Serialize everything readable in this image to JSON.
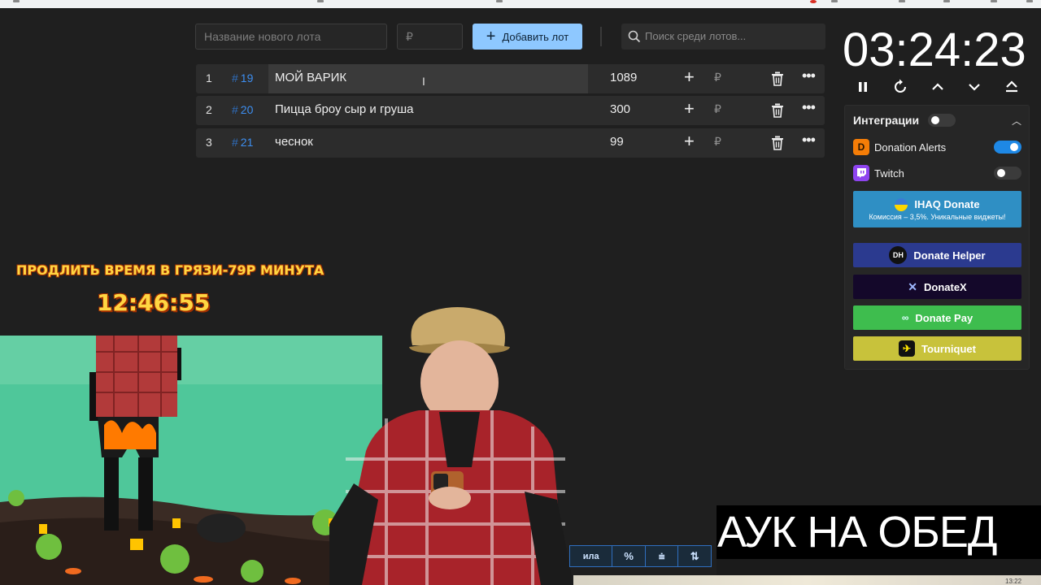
{
  "toolbar": {
    "lot_name_placeholder": "Название нового лота",
    "amount_placeholder": "₽",
    "add_label": "Добавить лот",
    "search_placeholder": "Поиск среди лотов..."
  },
  "lots": [
    {
      "num": "1",
      "id": "19",
      "name": "МОЙ ВАРИК",
      "amount": "1089",
      "currency": "₽"
    },
    {
      "num": "2",
      "id": "20",
      "name": "Пицца броу сыр и груша",
      "amount": "300",
      "currency": "₽"
    },
    {
      "num": "3",
      "id": "21",
      "name": "чеснок",
      "amount": "99",
      "currency": "₽"
    }
  ],
  "timer": {
    "value": "03:24:23"
  },
  "integrations": {
    "title": "Интеграции",
    "enabled": false,
    "services": [
      {
        "name": "Donation Alerts",
        "enabled": true,
        "logo": "D"
      },
      {
        "name": "Twitch",
        "enabled": false,
        "logo": "twitch-icon"
      }
    ]
  },
  "donate_buttons": [
    {
      "label": "IHAQ Donate",
      "sub": "Комиссия – 3,5%. Уникальные виджеты!",
      "color": "#2f8fc4",
      "icon": "ihaq-icon"
    },
    {
      "label": "Donate Helper",
      "color": "#2b3a8f",
      "icon": "DH"
    },
    {
      "label": "DonateX",
      "color": "#14082a",
      "icon": "x-icon"
    },
    {
      "label": "Donate Pay",
      "color": "#3ebd4e",
      "icon": "link-icon"
    },
    {
      "label": "Tourniquet",
      "color": "#c8c23b",
      "icon": "tourniquet-icon"
    }
  ],
  "overlay": {
    "extend_title": "ПРОДЛИТЬ ВРЕМЯ В ГРЯЗИ-79Р МИНУТА",
    "extend_timer": "12:46:55",
    "banner": "АУК НА ОБЕД",
    "bar_label": "ила",
    "bar_icons": [
      "%",
      "⩧",
      "⇅"
    ],
    "small_clock": "13:22"
  }
}
